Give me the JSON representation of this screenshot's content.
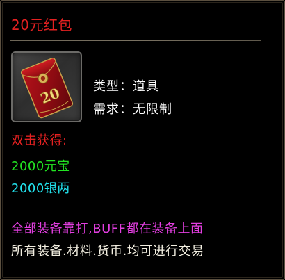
{
  "item": {
    "name": "20元红包",
    "icon": "red-envelope-icon",
    "type_label": "类型：",
    "type_value": "道具",
    "requirement_label": "需求：",
    "requirement_value": "无限制"
  },
  "usage": {
    "action": "双击获得:",
    "rewards": [
      "2000元宝",
      "2000银两"
    ]
  },
  "notes": [
    "全部装备靠打,BUFF都在装备上面",
    "所有装备.材料.货币.均可进行交易"
  ],
  "colors": {
    "title": "#e32121",
    "action": "#e32121",
    "reward_1": "#22e322",
    "reward_2": "#22e3ee",
    "note_1": "#e23ee0",
    "note_2": "#f2eee0",
    "attributes": "#ffffff"
  }
}
